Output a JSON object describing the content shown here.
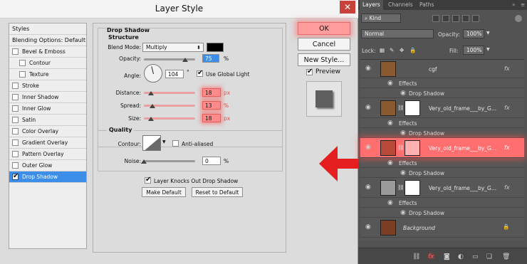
{
  "dialog": {
    "title": "Layer Style",
    "close": "✕",
    "styles_header": "Styles",
    "blending": "Blending Options: Default",
    "styles": [
      {
        "label": "Bevel & Emboss",
        "checked": false,
        "indent": false
      },
      {
        "label": "Contour",
        "checked": false,
        "indent": true
      },
      {
        "label": "Texture",
        "checked": false,
        "indent": true
      },
      {
        "label": "Stroke",
        "checked": false,
        "indent": false
      },
      {
        "label": "Inner Shadow",
        "checked": false,
        "indent": false
      },
      {
        "label": "Inner Glow",
        "checked": false,
        "indent": false
      },
      {
        "label": "Satin",
        "checked": false,
        "indent": false
      },
      {
        "label": "Color Overlay",
        "checked": false,
        "indent": false
      },
      {
        "label": "Gradient Overlay",
        "checked": false,
        "indent": false
      },
      {
        "label": "Pattern Overlay",
        "checked": false,
        "indent": false
      },
      {
        "label": "Outer Glow",
        "checked": false,
        "indent": false
      },
      {
        "label": "Drop Shadow",
        "checked": true,
        "indent": false
      }
    ],
    "drop_shadow": {
      "title": "Drop Shadow",
      "structure": "Structure",
      "blend_mode_label": "Blend Mode:",
      "blend_mode": "Multiply",
      "shadow_color": "#000000",
      "opacity_label": "Opacity:",
      "opacity": "75",
      "opacity_unit": "%",
      "angle_label": "Angle:",
      "angle": "104",
      "angle_unit": "°",
      "use_global_light": "Use Global Light",
      "distance_label": "Distance:",
      "distance": "18",
      "distance_unit": "px",
      "spread_label": "Spread:",
      "spread": "13",
      "spread_unit": "%",
      "size_label": "Size:",
      "size": "18",
      "size_unit": "px"
    },
    "quality": {
      "title": "Quality",
      "contour_label": "Contour:",
      "anti_aliased": "Anti-aliased",
      "noise_label": "Noise:",
      "noise": "0",
      "noise_unit": "%"
    },
    "knocks_out": "Layer Knocks Out Drop Shadow",
    "make_default": "Make Default",
    "reset_default": "Reset to Default",
    "ok": "OK",
    "cancel": "Cancel",
    "new_style": "New Style...",
    "preview": "Preview"
  },
  "layers": {
    "tabs": [
      "Layers",
      "Channels",
      "Paths"
    ],
    "kind": "Kind",
    "blend": "Normal",
    "opacity_label": "Opacity:",
    "opacity": "100%",
    "lock_label": "Lock:",
    "fill_label": "Fill:",
    "fill": "100%",
    "items": [
      {
        "name": "cgf",
        "effects": "Effects",
        "effect": "Drop Shadow"
      },
      {
        "name": "Very_old_frame___by_G...",
        "effects": "Effects",
        "effect": "Drop Shadow"
      },
      {
        "name": "Very_old_frame___by_G...",
        "effects": "Effects",
        "effect": "Drop Shadow"
      },
      {
        "name": "Very_old_frame___by_G...",
        "effects": "Effects",
        "effect": "Drop Shadow"
      },
      {
        "name": "Background"
      }
    ],
    "fx": "fx"
  }
}
